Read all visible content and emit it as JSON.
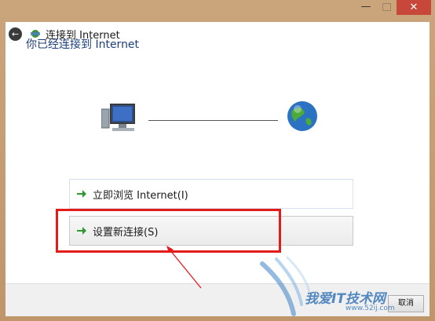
{
  "window": {
    "minimize_glyph": "—",
    "close_glyph": "✕"
  },
  "nav": {
    "title": "连接到 Internet"
  },
  "content": {
    "headline": "你已经连接到 Internet"
  },
  "links": [
    {
      "label": "立即浏览 Internet(I)"
    },
    {
      "label": "设置新连接(S)"
    }
  ],
  "footer": {
    "cancel_label": "取消"
  },
  "watermark": {
    "text": "我爱IT技术网",
    "url": "www.52ij.com"
  },
  "colors": {
    "frame": "#c8a075",
    "close": "#c7473b",
    "headline": "#1e3f7c",
    "annotation": "#e31b1b",
    "arrow_green": "#2e9a2e"
  },
  "icons": [
    "back-arrow-icon",
    "network-icon",
    "computer-icon",
    "globe-icon",
    "green-arrow-icon"
  ]
}
